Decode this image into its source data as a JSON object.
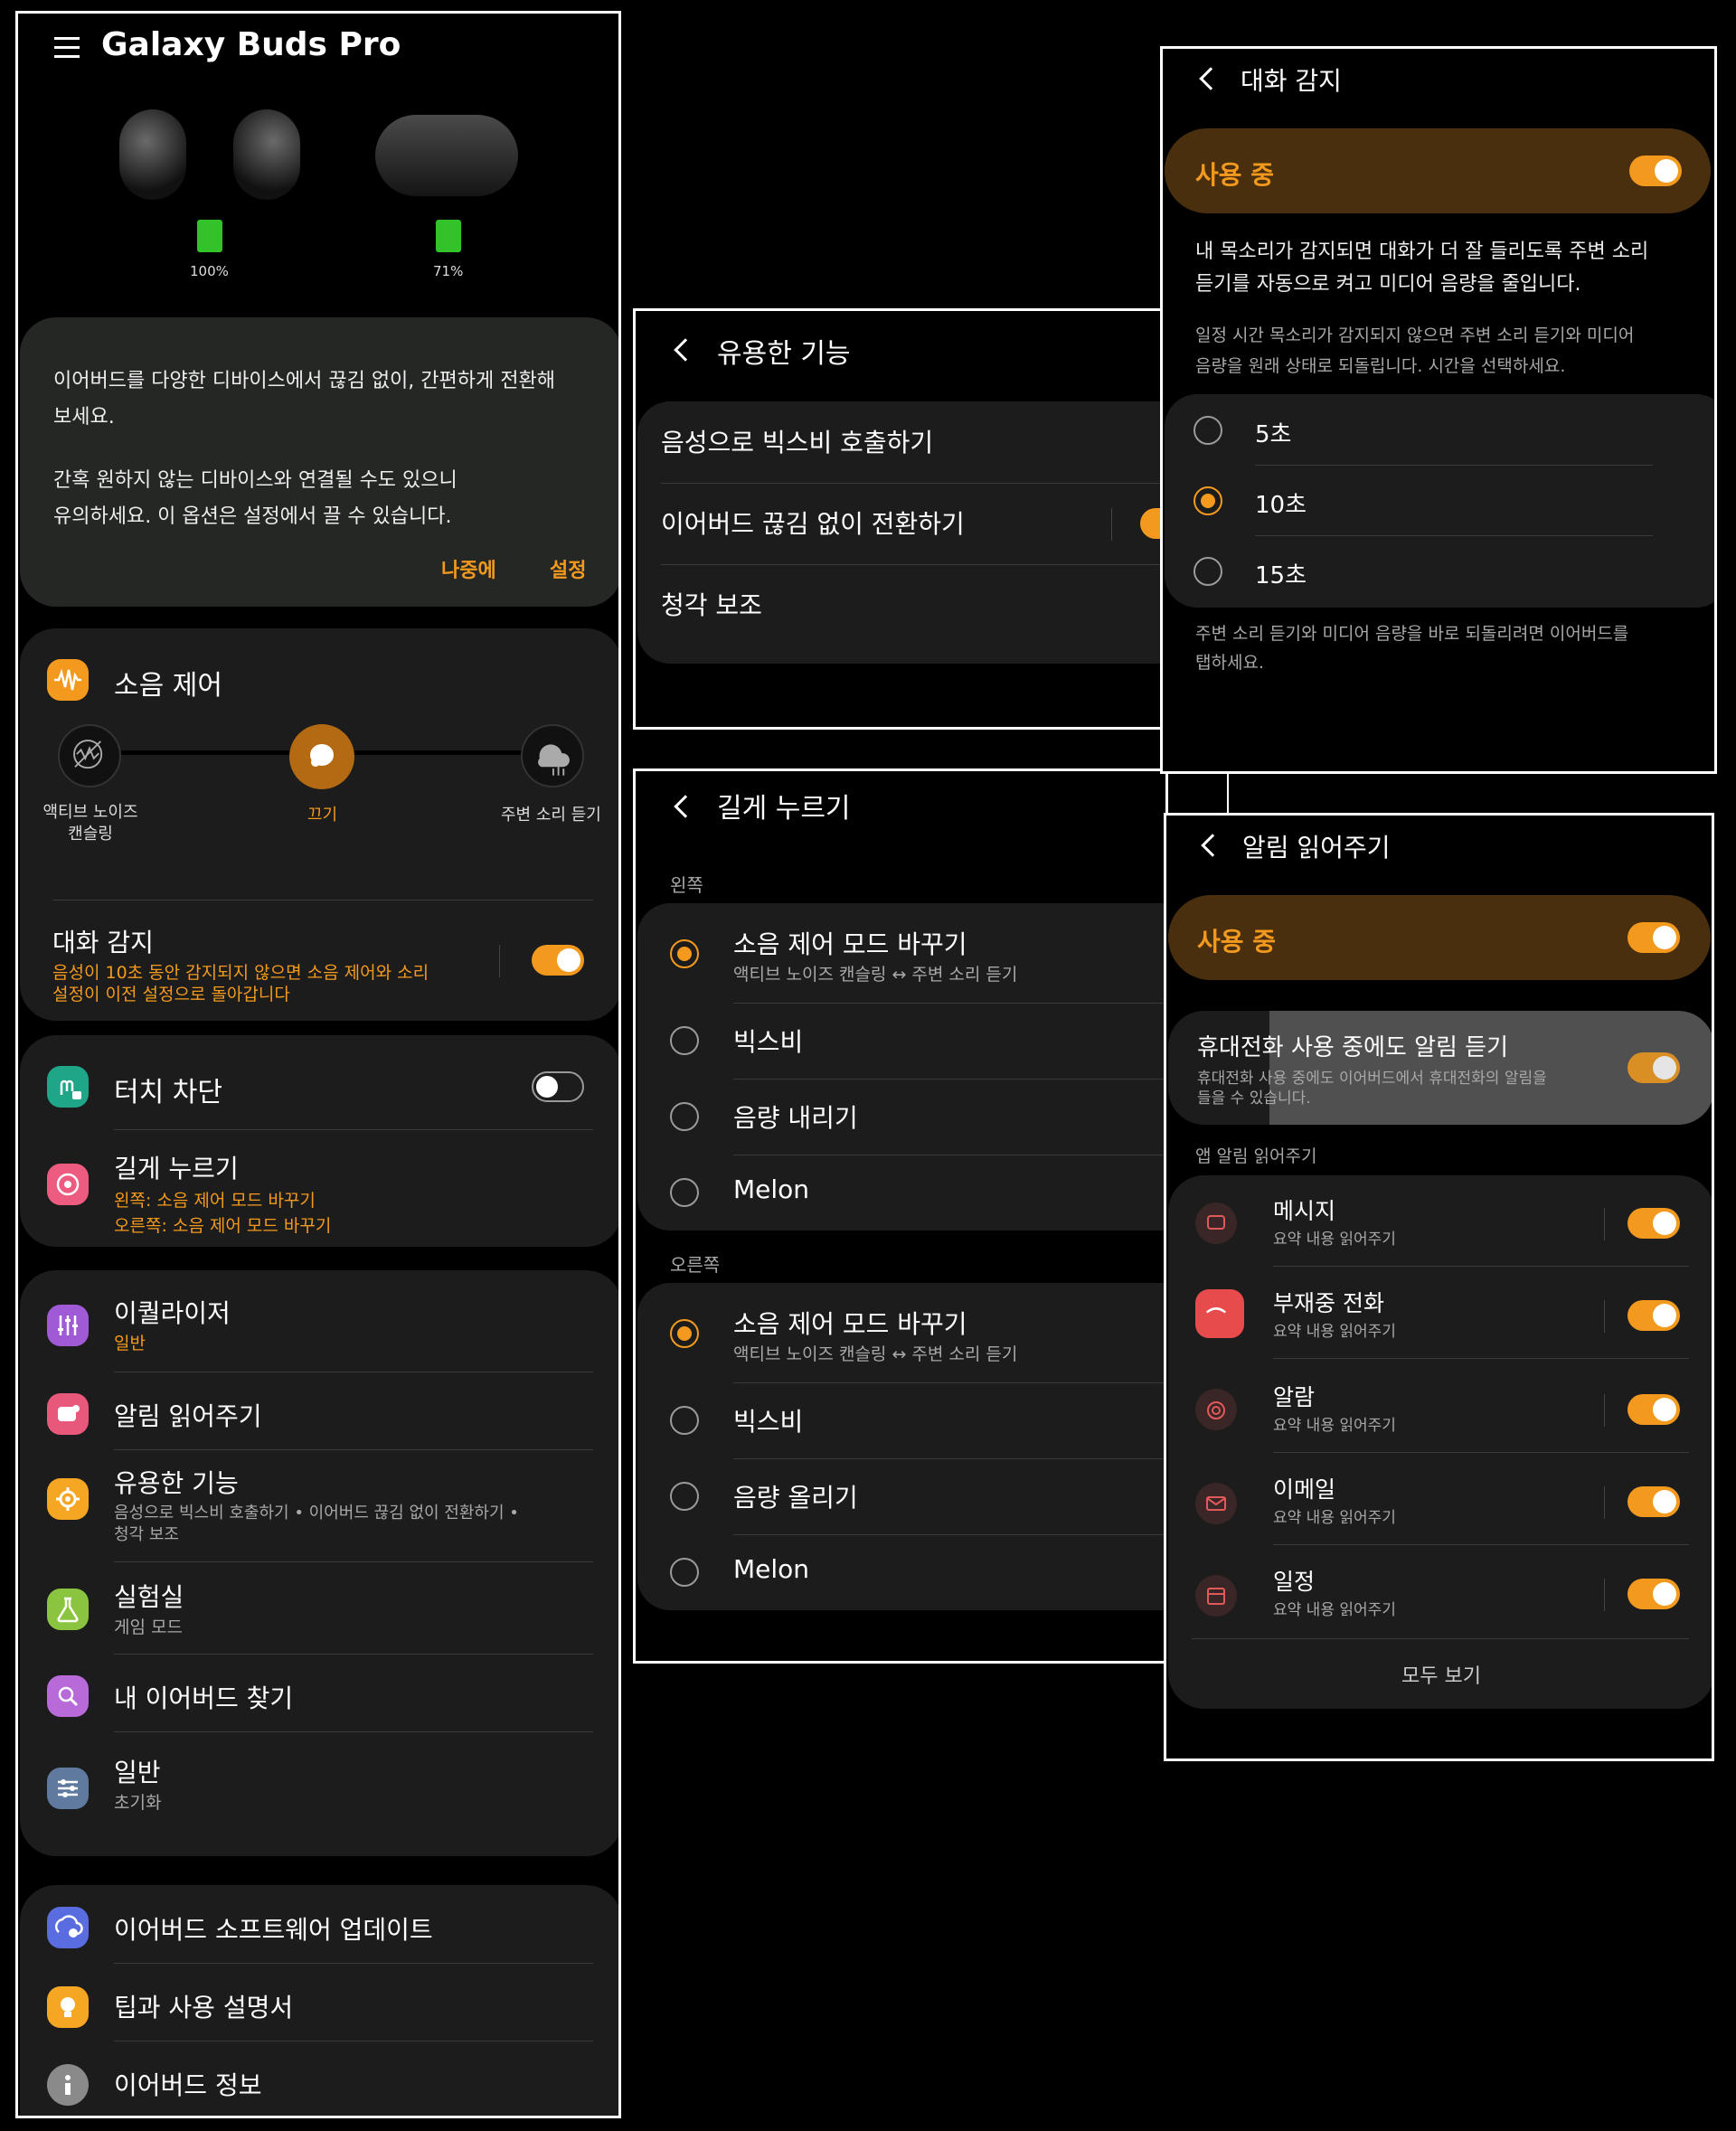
{
  "main": {
    "app_title": "Galaxy Buds Pro",
    "battery_buds": "100%",
    "battery_case": "71%",
    "notice": {
      "line1": "이어버드를 다양한 디바이스에서 끊김 없이, 간편하게 전환해",
      "line2": "보세요.",
      "line3": "간혹 원하지 않는 디바이스와 연결될 수도 있으니",
      "line4": "유의하세요. 이 옵션은 설정에서 끌 수 있습니다.",
      "later": "나중에",
      "settings": "설정"
    },
    "noise": {
      "title": "소음 제어",
      "anc_line1": "액티브 노이즈",
      "anc_line2": "캔슬링",
      "off": "끄기",
      "ambient": "주변 소리 듣기",
      "conv_title": "대화 감지",
      "conv_desc1": "음성이 10초 동안 감지되지 않으면 소음 제어와 소리",
      "conv_desc2": "설정이 이전 설정으로 돌아갑니다"
    },
    "touch": {
      "block_title": "터치 차단",
      "long_title": "길게 누르기",
      "long_left": "왼쪽: 소음 제어 모드 바꾸기",
      "long_right": "오른쪽: 소음 제어 모드 바꾸기"
    },
    "list": {
      "eq_title": "이퀄라이저",
      "eq_sub": "일반",
      "notif_title": "알림 읽어주기",
      "useful_title": "유용한 기능",
      "useful_sub1": "음성으로 빅스비 호출하기  •  이어버드 끊김 없이 전환하기  •",
      "useful_sub2": "청각 보조",
      "lab_title": "실험실",
      "lab_sub": "게임 모드",
      "find_title": "내 이어버드 찾기",
      "general_title": "일반",
      "general_sub": "초기화"
    },
    "bottom": {
      "update": "이어버드 소프트웨어 업데이트",
      "tips": "팁과 사용 설명서",
      "info": "이어버드 정보"
    }
  },
  "useful_panel": {
    "title": "유용한 기능",
    "items": [
      "음성으로 빅스비 호출하기",
      "이어버드 끊김 없이 전환하기",
      "청각 보조"
    ]
  },
  "long_panel": {
    "title": "길게 누르기",
    "left_label": "왼쪽",
    "right_label": "오른쪽",
    "left_items": [
      "소음 제어 모드 바꾸기",
      "빅스비",
      "음량 내리기",
      "Melon"
    ],
    "right_items": [
      "소음 제어 모드 바꾸기",
      "빅스비",
      "음량 올리기",
      "Melon"
    ],
    "mode_sub": "액티브 노이즈 캔슬링  ↔  주변 소리 듣기"
  },
  "conv_panel": {
    "title": "대화 감지",
    "in_use": "사용 중",
    "desc1": "내 목소리가 감지되면 대화가 더 잘 들리도록 주변 소리",
    "desc2": "듣기를 자동으로 켜고 미디어 음량을 줄입니다.",
    "note1": "일정 시간 목소리가 감지되지 않으면 주변 소리 듣기와 미디어",
    "note2": "음량을 원래 상태로 되돌립니다. 시간을 선택하세요.",
    "options": [
      "5초",
      "10초",
      "15초"
    ],
    "selected": "10초",
    "foot1": "주변 소리 듣기와 미디어 음량을 바로 되돌리려면 이어버드를",
    "foot2": "탭하세요."
  },
  "notif_panel": {
    "title": "알림 읽어주기",
    "in_use": "사용 중",
    "phone_title": "휴대전화 사용 중에도 알림 듣기",
    "phone_desc1": "휴대전화 사용 중에도 이어버드에서 휴대전화의 알림을",
    "phone_desc2": "들을 수 있습니다.",
    "section": "앱 알림 읽어주기",
    "apps": [
      {
        "name": "메시지",
        "sub": "요약 내용 읽어주기"
      },
      {
        "name": "부재중 전화",
        "sub": "요약 내용 읽어주기"
      },
      {
        "name": "알람",
        "sub": "요약 내용 읽어주기"
      },
      {
        "name": "이메일",
        "sub": "요약 내용 읽어주기"
      },
      {
        "name": "일정",
        "sub": "요약 내용 읽어주기"
      }
    ],
    "see_all": "모두 보기"
  },
  "colors": {
    "accent": "#f39a1e",
    "card": "#1c1c1c",
    "in_use_bar": "#4a2f0e"
  }
}
